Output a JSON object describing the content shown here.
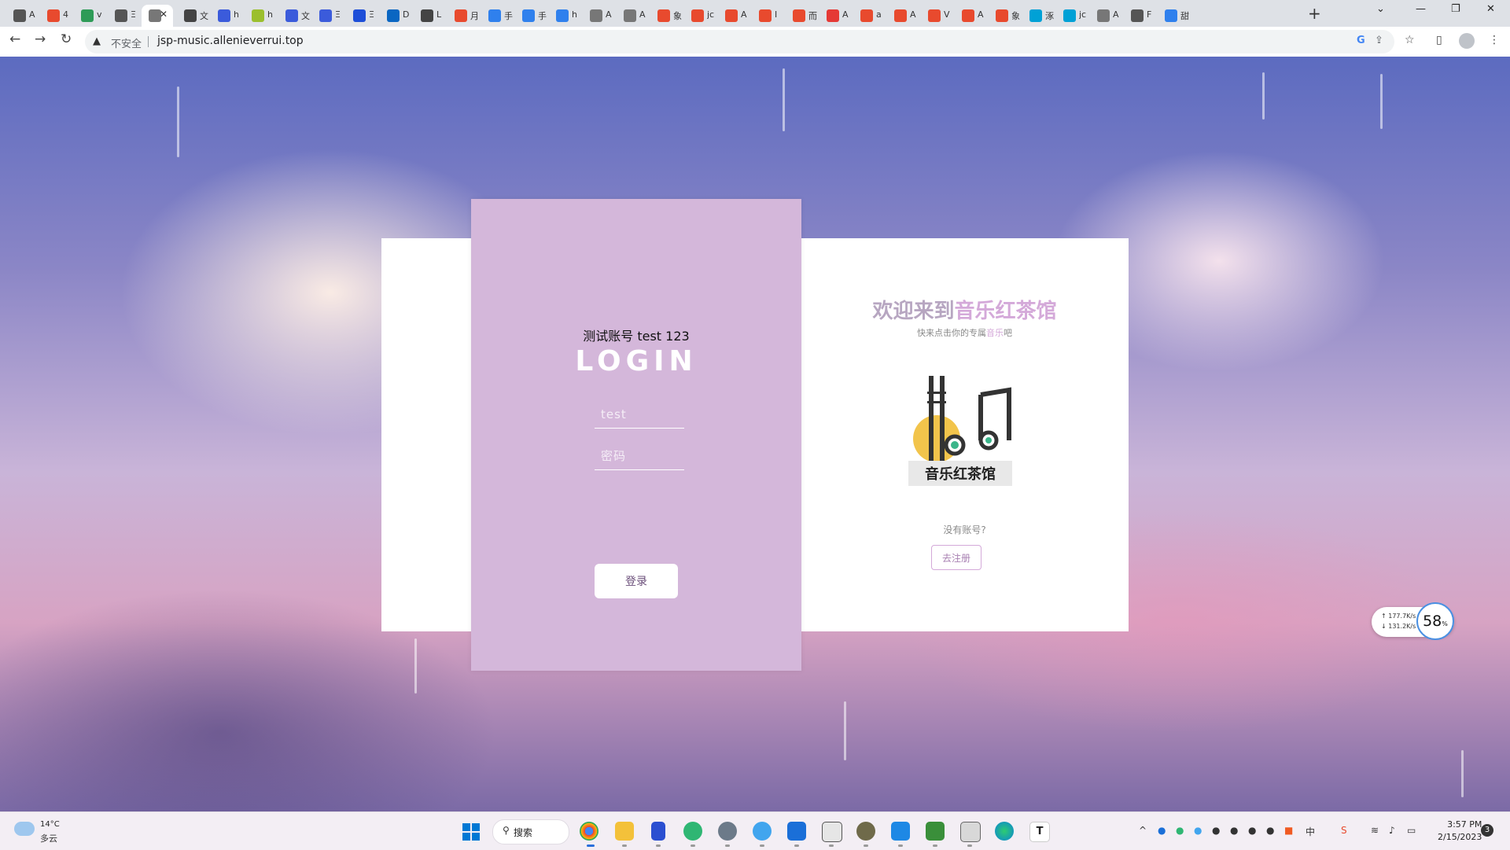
{
  "browser": {
    "tabs": [
      {
        "title": "A",
        "color": "#555"
      },
      {
        "title": "4",
        "color": "#e84a2e"
      },
      {
        "title": "v",
        "color": "#2e9b57"
      },
      {
        "title": "Ξ",
        "color": "#555"
      },
      {
        "title": "",
        "color": "#777",
        "active": true
      },
      {
        "title": "文",
        "color": "#444"
      },
      {
        "title": "h",
        "color": "#3b5bdb"
      },
      {
        "title": "h",
        "color": "#9bbf2e"
      },
      {
        "title": "文",
        "color": "#3b5bdb"
      },
      {
        "title": "Ξ",
        "color": "#3b5bdb"
      },
      {
        "title": "Ξ",
        "color": "#1d4ed8"
      },
      {
        "title": "D",
        "color": "#0a66c2"
      },
      {
        "title": "L",
        "color": "#444"
      },
      {
        "title": "月",
        "color": "#e84a2e"
      },
      {
        "title": "手",
        "color": "#2f80ed"
      },
      {
        "title": "手",
        "color": "#2f80ed"
      },
      {
        "title": "h",
        "color": "#2f80ed"
      },
      {
        "title": "A",
        "color": "#777"
      },
      {
        "title": "A",
        "color": "#777"
      },
      {
        "title": "象",
        "color": "#e84a2e"
      },
      {
        "title": "jc",
        "color": "#e84a2e"
      },
      {
        "title": "A",
        "color": "#e84a2e"
      },
      {
        "title": "I",
        "color": "#e84a2e"
      },
      {
        "title": "而",
        "color": "#e84a2e"
      },
      {
        "title": "A",
        "color": "#e53935"
      },
      {
        "title": "a",
        "color": "#e84a2e"
      },
      {
        "title": "A",
        "color": "#e84a2e"
      },
      {
        "title": "V",
        "color": "#e84a2e"
      },
      {
        "title": "A",
        "color": "#e84a2e"
      },
      {
        "title": "象",
        "color": "#e84a2e"
      },
      {
        "title": "涿",
        "color": "#00a1d6"
      },
      {
        "title": "jc",
        "color": "#00a1d6"
      },
      {
        "title": "A",
        "color": "#777"
      },
      {
        "title": "F",
        "color": "#555"
      },
      {
        "title": "甜",
        "color": "#2f80ed"
      }
    ],
    "insecure_label": "不安全",
    "url": "jsp-music.allenieverrui.top"
  },
  "login": {
    "test_account": "测试账号 test 123",
    "title": "LOGIN",
    "username_placeholder": "test",
    "password_placeholder": "密码",
    "submit_label": "登录"
  },
  "welcome": {
    "heading_prefix": "欢迎来到",
    "heading_accent": "音乐红茶馆",
    "sub_prefix": "快来点击你的专属",
    "sub_accent": "音乐",
    "sub_suffix": "吧",
    "logo_text": "音乐红茶馆",
    "no_account": "没有账号?",
    "register_label": "去注册"
  },
  "netmon": {
    "up": "177.7K/s",
    "down": "131.2K/s",
    "percent": "58",
    "percent_unit": "%"
  },
  "taskbar": {
    "temp": "14°C",
    "condition": "多云",
    "search_label": "搜索",
    "time": "3:57 PM",
    "date": "2/15/2023",
    "notifications": "3"
  },
  "colors": {
    "panel": "#d4b7da",
    "accent": "#d4a9d9",
    "heading": "#b7a6c1"
  }
}
